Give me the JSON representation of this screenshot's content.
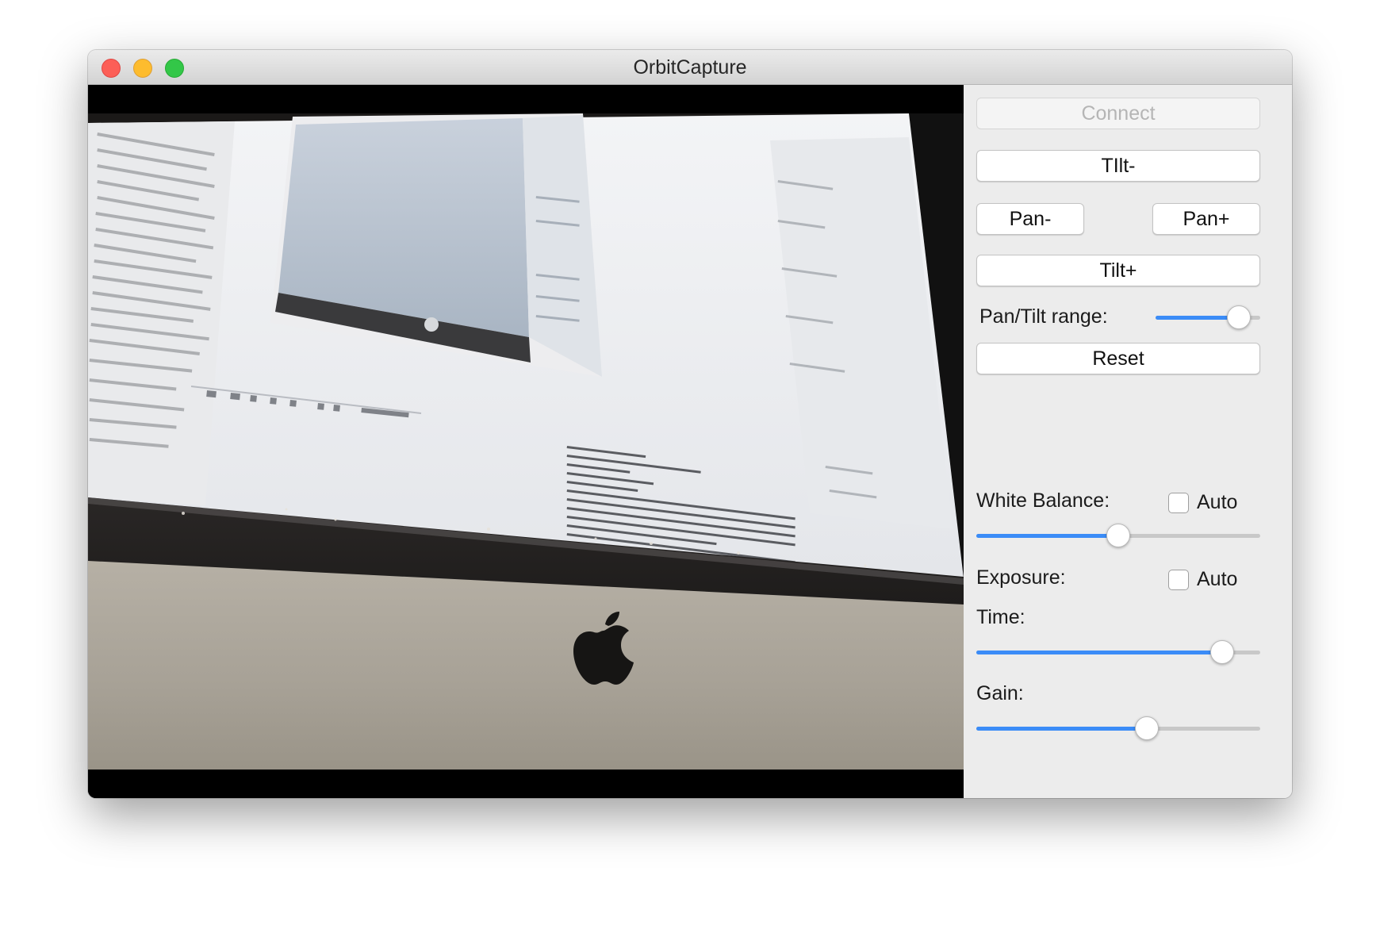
{
  "window": {
    "title": "OrbitCapture"
  },
  "panel": {
    "connect_label": "Connect",
    "tilt_minus_label": "TIlt-",
    "pan_minus_label": "Pan-",
    "pan_plus_label": "Pan+",
    "tilt_plus_label": "Tilt+",
    "pan_tilt_range_label": "Pan/Tilt range:",
    "pan_tilt_range_value": 0.88,
    "reset_label": "Reset",
    "white_balance_label": "White Balance:",
    "white_balance_auto_label": "Auto",
    "white_balance_auto_checked": false,
    "white_balance_value": 0.5,
    "exposure_label": "Exposure:",
    "exposure_auto_label": "Auto",
    "exposure_auto_checked": false,
    "time_label": "Time:",
    "time_value": 0.9,
    "gain_label": "Gain:",
    "gain_value": 0.61
  },
  "colors": {
    "accent": "#3b8cf7",
    "close": "#fc5f57",
    "minimize": "#fdbc2e",
    "maximize": "#33c748"
  }
}
